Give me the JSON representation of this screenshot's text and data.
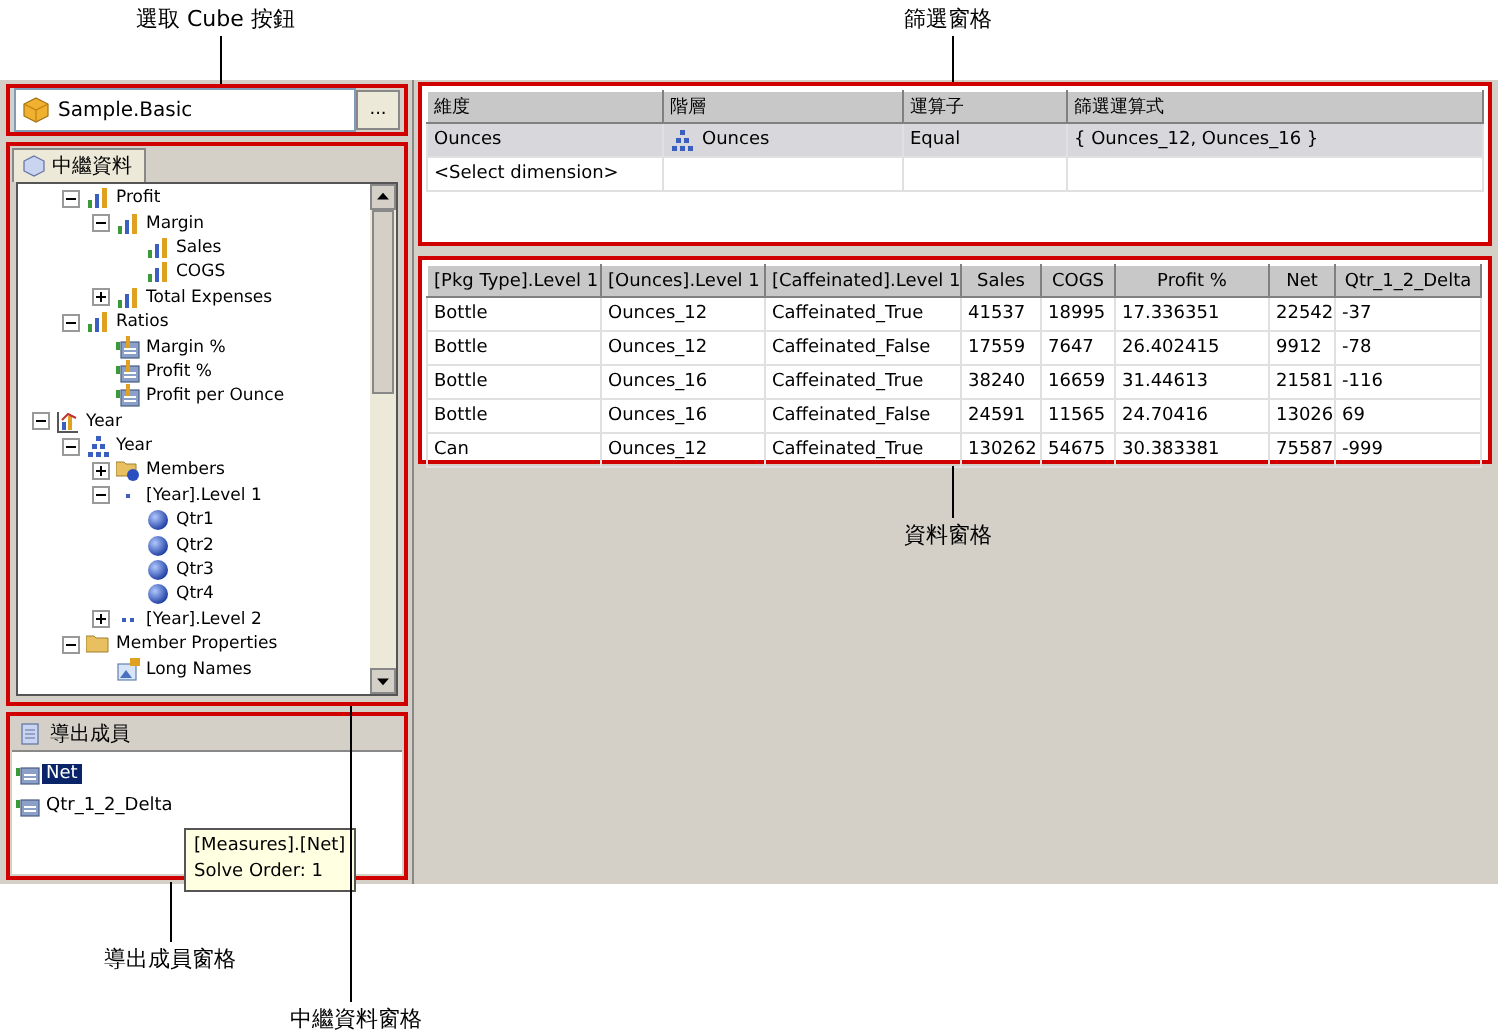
{
  "callouts": {
    "cube_button": "選取 Cube 按鈕",
    "filter_pane": "篩選窗格",
    "data_pane": "資料窗格",
    "derived_pane": "導出成員窗格",
    "metadata_pane": "中繼資料窗格"
  },
  "cube_selector": {
    "value": "Sample.Basic",
    "button": "..."
  },
  "metadata_pane": {
    "tab": "中繼資料",
    "tree": [
      {
        "children": [
          {
            "label": "Profit",
            "kind": "measure",
            "expanded": true,
            "children": [
              {
                "label": "Margin",
                "kind": "measure",
                "expanded": true,
                "children": [
                  {
                    "label": "Sales",
                    "kind": "measure"
                  },
                  {
                    "label": "COGS",
                    "kind": "measure"
                  }
                ]
              },
              {
                "label": "Total Expenses",
                "kind": "measure",
                "expanded": false
              }
            ]
          },
          {
            "label": "Ratios",
            "kind": "measure",
            "expanded": true,
            "children": [
              {
                "label": "Margin %",
                "kind": "formula"
              },
              {
                "label": "Profit %",
                "kind": "formula"
              },
              {
                "label": "Profit per Ounce",
                "kind": "formula"
              }
            ]
          }
        ]
      },
      {
        "label": "Year",
        "kind": "dimension",
        "expanded": true,
        "children": [
          {
            "label": "Year",
            "kind": "hierarchy",
            "expanded": true,
            "children": [
              {
                "label": "Members",
                "kind": "members",
                "expanded": false
              },
              {
                "label": "[Year].Level 1",
                "kind": "level1",
                "expanded": true,
                "children": [
                  {
                    "label": "Qtr1",
                    "kind": "member"
                  },
                  {
                    "label": "Qtr2",
                    "kind": "member"
                  },
                  {
                    "label": "Qtr3",
                    "kind": "member"
                  },
                  {
                    "label": "Qtr4",
                    "kind": "member"
                  }
                ]
              },
              {
                "label": "[Year].Level 2",
                "kind": "level2",
                "expanded": false
              }
            ]
          },
          {
            "label": "Member Properties",
            "kind": "folder",
            "expanded": true,
            "children": [
              {
                "label": "Long Names",
                "kind": "property"
              }
            ]
          }
        ]
      }
    ]
  },
  "derived_pane": {
    "title": "導出成員",
    "items": [
      {
        "label": "Net",
        "selected": true
      },
      {
        "label": "Qtr_1_2_Delta",
        "selected": false
      }
    ],
    "tooltip": [
      "[Measures].[Net]",
      "Solve Order: 1"
    ]
  },
  "filter_pane": {
    "columns": [
      "維度",
      "階層",
      "運算子",
      "篩選運算式"
    ],
    "rows": [
      {
        "dimension": "Ounces",
        "hierarchy": "Ounces",
        "operator": "Equal",
        "expression": "{ Ounces_12, Ounces_16 }",
        "selected": true
      },
      {
        "dimension": "<Select dimension>",
        "selected": false
      }
    ]
  },
  "data_pane": {
    "columns": [
      "[Pkg Type].Level 1",
      "[Ounces].Level 1",
      "[Caffeinated].Level 1",
      "Sales",
      "COGS",
      "Profit %",
      "Net",
      "Qtr_1_2_Delta"
    ],
    "rows": [
      [
        "Bottle",
        "Ounces_12",
        "Caffeinated_True",
        "41537",
        "18995",
        "17.336351",
        "22542",
        "-37"
      ],
      [
        "Bottle",
        "Ounces_12",
        "Caffeinated_False",
        "17559",
        "7647",
        "26.402415",
        "9912",
        "-78"
      ],
      [
        "Bottle",
        "Ounces_16",
        "Caffeinated_True",
        "38240",
        "16659",
        "31.44613",
        "21581",
        "-116"
      ],
      [
        "Bottle",
        "Ounces_16",
        "Caffeinated_False",
        "24591",
        "11565",
        "24.70416",
        "13026",
        "69"
      ],
      [
        "Can",
        "Ounces_12",
        "Caffeinated_True",
        "130262",
        "54675",
        "30.383381",
        "75587",
        "-999"
      ]
    ]
  }
}
